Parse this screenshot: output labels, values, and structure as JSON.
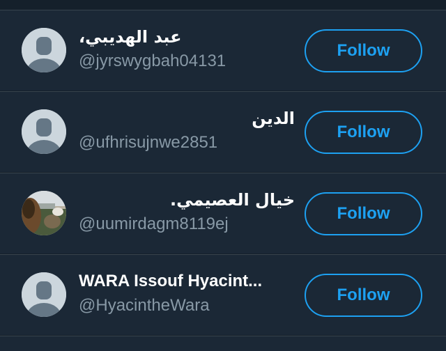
{
  "follow_suggestions": [
    {
      "name": "عبد الهديبي،",
      "handle": "@jyrswygbah04131",
      "follow_label": "Follow",
      "avatar": "default-avatar-icon"
    },
    {
      "name": "الدين",
      "handle": "@ufhrisujnwe2851",
      "follow_label": "Follow",
      "avatar": "default-avatar-icon"
    },
    {
      "name": "خيال العصيمي.",
      "handle": "@uumirdagm8119ej",
      "follow_label": "Follow",
      "avatar": "photo-avatar"
    },
    {
      "name": "WARA Issouf Hyacint...",
      "handle": "@HyacintheWara",
      "follow_label": "Follow",
      "avatar": "default-avatar-icon"
    }
  ],
  "colors": {
    "background": "#15202b",
    "row_background": "#1b2836",
    "divider": "#38444d",
    "name_text": "#ffffff",
    "handle_text": "#8899a6",
    "accent": "#1da1f2",
    "avatar_placeholder_bg": "#ccd6dd",
    "avatar_placeholder_fg": "#657786"
  }
}
